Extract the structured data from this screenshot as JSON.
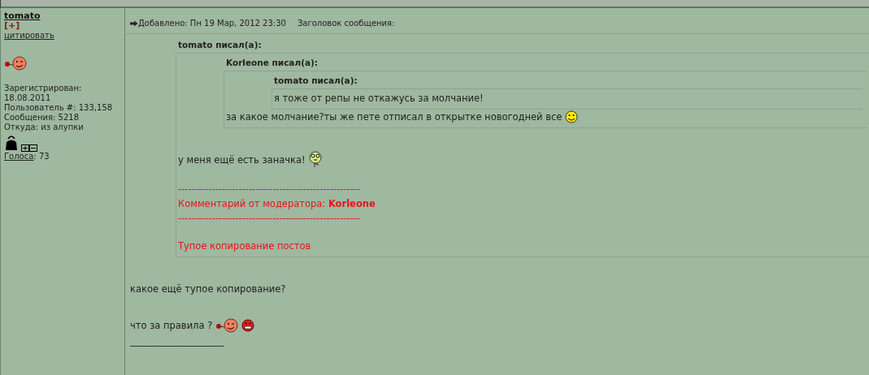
{
  "author": {
    "name": "tomato",
    "badge": "[+]",
    "quote_link": "цитировать",
    "info": [
      "Зарегистрирован:",
      "18.08.2011",
      "Пользователь #: 133,158",
      "Сообщения: 5218",
      "Откуда: из алупки"
    ],
    "votes_link": "Голоса",
    "votes_value": ": 73"
  },
  "post": {
    "posted": "Добавлено: Пн 19 Мар, 2012 23:30",
    "subject_label": "Заголовок сообщения:",
    "body": [
      {
        "kind": "quote",
        "title": "tomato писал(а):",
        "body": [
          {
            "kind": "quote",
            "title": "Korleone писал(а):",
            "body": [
              {
                "kind": "quote",
                "title": "tomato писал(а):",
                "body": [
                  {
                    "kind": "text",
                    "text": "я тоже от репы не откажусь за молчание!"
                  }
                ]
              },
              {
                "kind": "text_smile",
                "text": "за какое молчание?ты же пете отписал в открытке новогодней все"
              }
            ]
          },
          {
            "kind": "text_dazed",
            "text": "у меня ещё есть заначка!"
          },
          {
            "kind": "mod",
            "text": "------------------------------------------------------"
          },
          {
            "kind": "mod",
            "text": "Комментарий от модератора: **Korleone**"
          },
          {
            "kind": "mod",
            "text": "------------------------------------------------------"
          },
          {
            "kind": "mod",
            "text": "Тупое копирование постов"
          }
        ]
      },
      {
        "kind": "text",
        "text": "какое ещё тупое копирование?"
      },
      {
        "kind": "text_angry",
        "text": "что за правила ?"
      },
      {
        "kind": "text",
        "text": "____________________"
      }
    ]
  }
}
